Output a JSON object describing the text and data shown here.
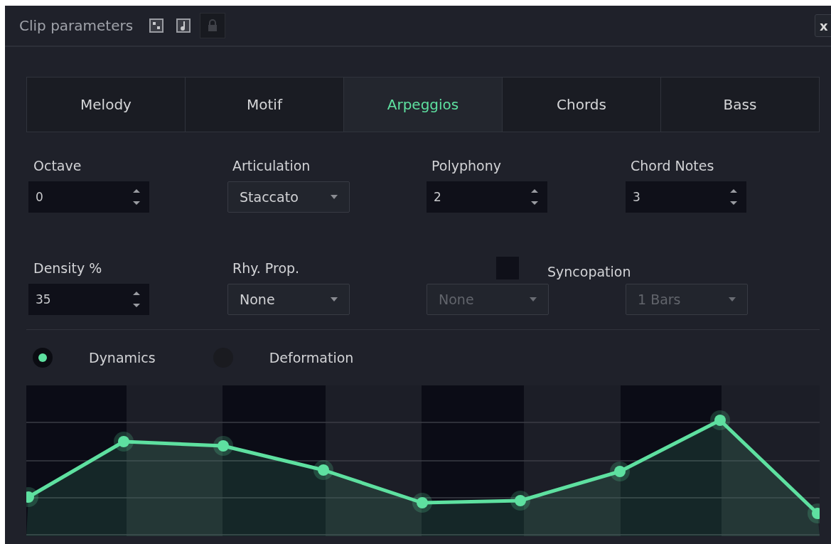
{
  "window": {
    "title": "Clip parameters",
    "close": "x"
  },
  "tabs": [
    {
      "label": "Melody",
      "selected": false
    },
    {
      "label": "Motif",
      "selected": false
    },
    {
      "label": "Arpeggios",
      "selected": true
    },
    {
      "label": "Chords",
      "selected": false
    },
    {
      "label": "Bass",
      "selected": false
    }
  ],
  "fields": [
    {
      "kind": "spinbox",
      "label": "Octave",
      "value": "0"
    },
    {
      "kind": "dropdown",
      "label": "Articulation",
      "value": "Staccato",
      "disabled": false
    },
    {
      "kind": "spinbox",
      "label": "Polyphony",
      "value": "2"
    },
    {
      "kind": "spinbox",
      "label": "Chord Notes",
      "value": "3"
    },
    {
      "kind": "spinbox",
      "label": "Density %",
      "value": "35"
    },
    {
      "kind": "dropdown",
      "label": "Rhy. Prop.",
      "value": "None",
      "disabled": false
    }
  ],
  "syncopation": {
    "label": "Syncopation",
    "checked": false,
    "selects": [
      {
        "value": "None",
        "disabled": true
      },
      {
        "value": "1 Bars",
        "disabled": true
      }
    ]
  },
  "curve_modes": [
    {
      "label": "Dynamics",
      "selected": true
    },
    {
      "label": "Deformation",
      "selected": false
    }
  ]
}
